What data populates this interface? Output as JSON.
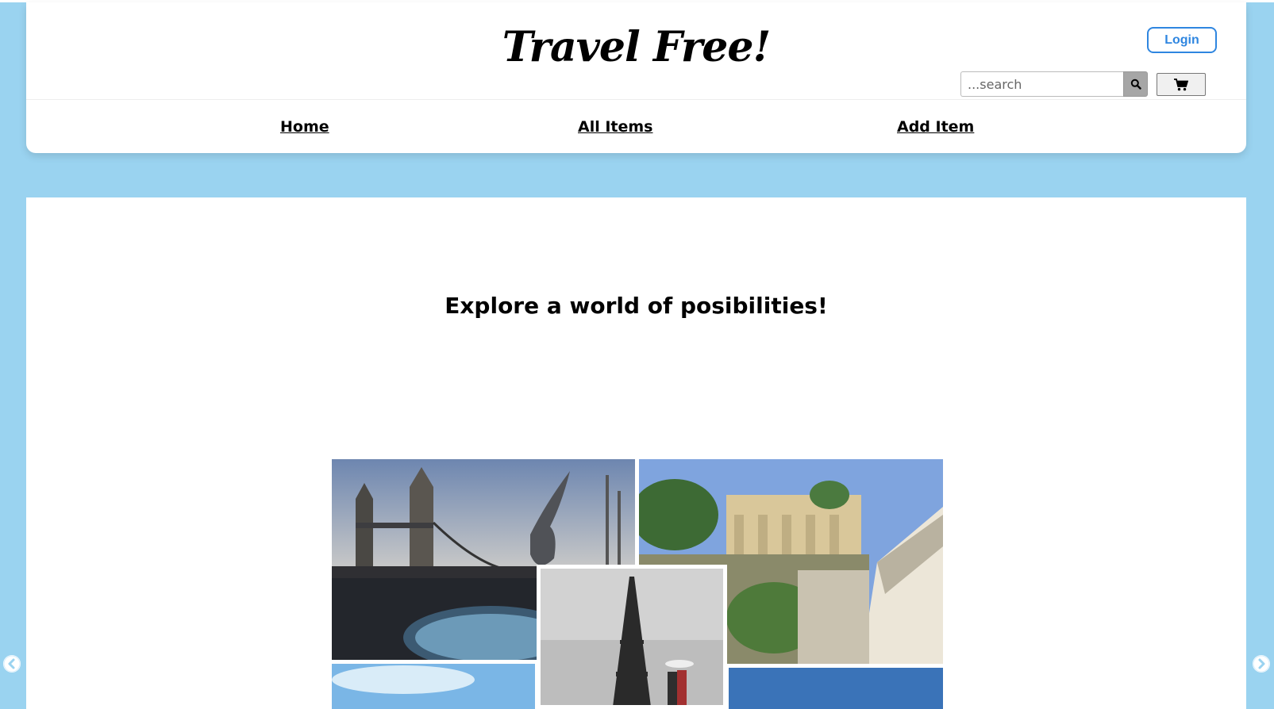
{
  "header": {
    "logo": "Travel Free!",
    "login_label": "Login",
    "search": {
      "placeholder": "...search",
      "value": ""
    },
    "icons": {
      "search": "search-icon",
      "cart": "cart-icon"
    }
  },
  "nav": {
    "items": [
      {
        "label": "Home"
      },
      {
        "label": "All Items"
      },
      {
        "label": "Add Item"
      }
    ]
  },
  "main": {
    "headline": "Explore a world of posibilities!",
    "collage_scenes": [
      "Tower Bridge London",
      "Park Guell Barcelona",
      "Eiffel Tower Paris",
      "blue sky",
      "blue sky"
    ]
  },
  "carousel": {
    "prev_icon": "chevron-left-icon",
    "next_icon": "chevron-right-icon"
  },
  "colors": {
    "page_background": "#9ad3f0",
    "accent": "#2f86e0",
    "panel": "#ffffff"
  }
}
